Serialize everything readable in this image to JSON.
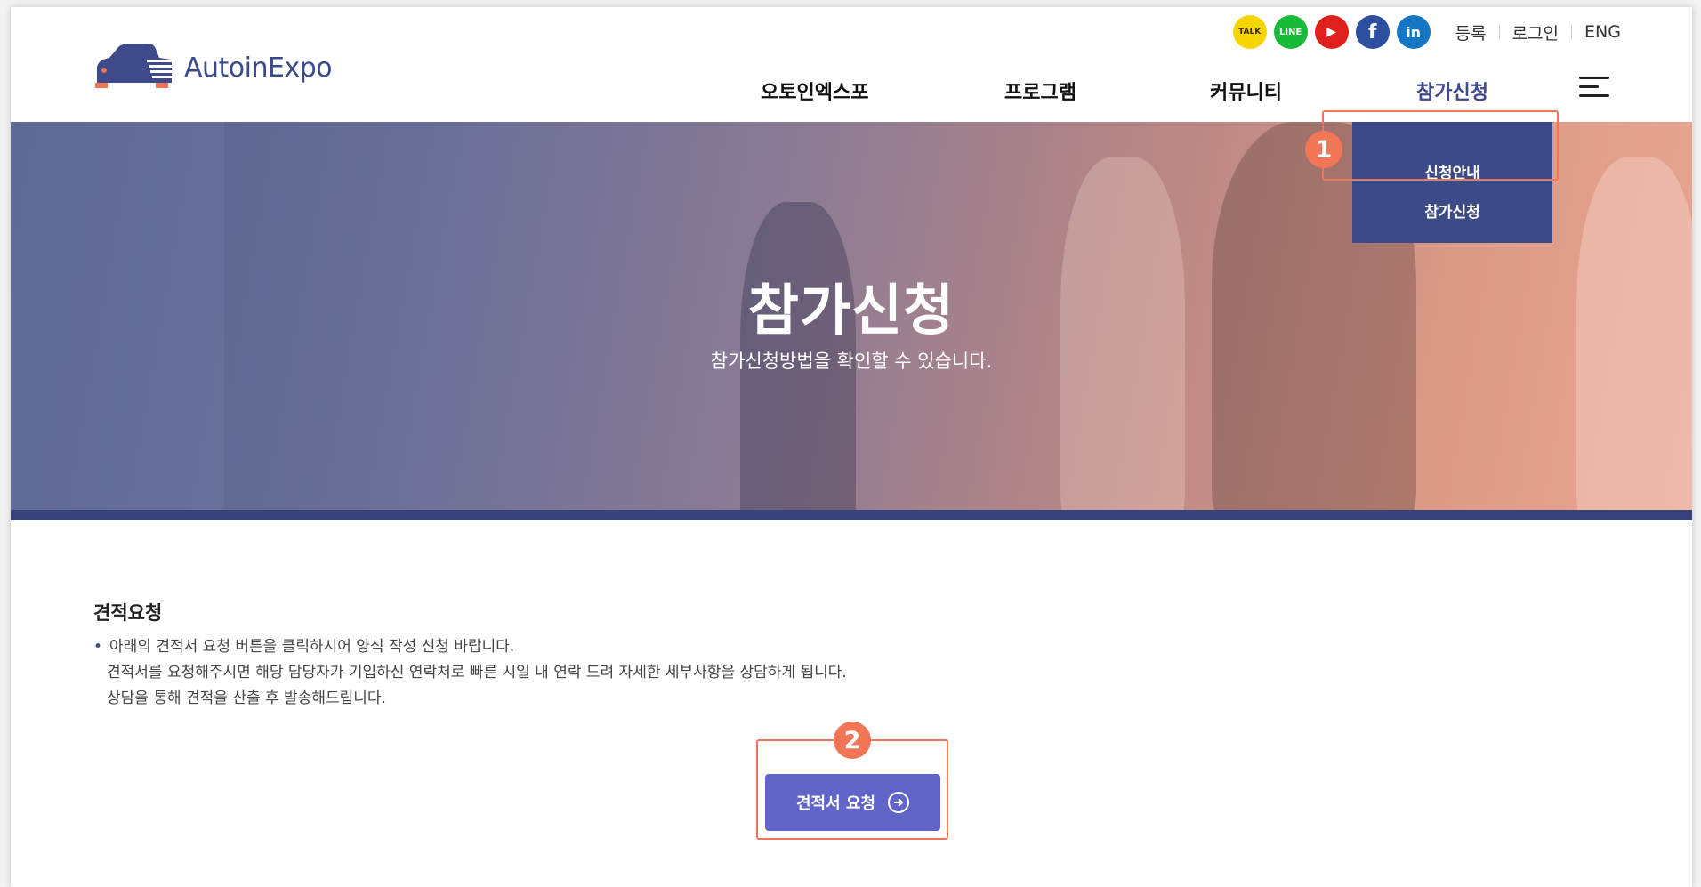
{
  "logo": {
    "text": "AutoinExpo"
  },
  "topbar": {
    "social": [
      {
        "icon": "kakaotalk-icon",
        "label": "TALK",
        "color": "#f7d500"
      },
      {
        "icon": "line-icon",
        "label": "LINE",
        "color": "#19b93a"
      },
      {
        "icon": "youtube-icon",
        "label": "▶",
        "color": "#e0201c"
      },
      {
        "icon": "facebook-icon",
        "label": "f",
        "color": "#2c4fa0"
      },
      {
        "icon": "linkedin-icon",
        "label": "in",
        "color": "#1576c3"
      }
    ],
    "links": [
      "등록",
      "로그인",
      "ENG"
    ]
  },
  "nav": {
    "items": [
      "오토인엑스포",
      "프로그램",
      "커뮤니티",
      "참가신청"
    ],
    "active": "참가신청"
  },
  "dropdown": {
    "items": [
      "신청안내",
      "참가신청"
    ]
  },
  "hero": {
    "title": "참가신청",
    "subtitle": "참가신청방법을 확인할 수 있습니다."
  },
  "badges": {
    "first": "1",
    "second": "2"
  },
  "content": {
    "section_title": "견적요청",
    "lines": [
      "아래의 견적서 요청 버튼을 클릭하시어 양식 작성 신청 바랍니다.",
      "견적서를 요청해주시면 해당 담당자가 기입하신 연락처로 빠른 시일 내 연락 드려 자세한 세부사항을 상담하게 됩니다.",
      "상담을 통해 견적을 산출 후 발송해드립니다."
    ],
    "bullet": "•",
    "button_label": "견적서 요청"
  },
  "colors": {
    "accent": "#3e4a8a",
    "button": "#6165c8",
    "highlight": "#f07656"
  }
}
